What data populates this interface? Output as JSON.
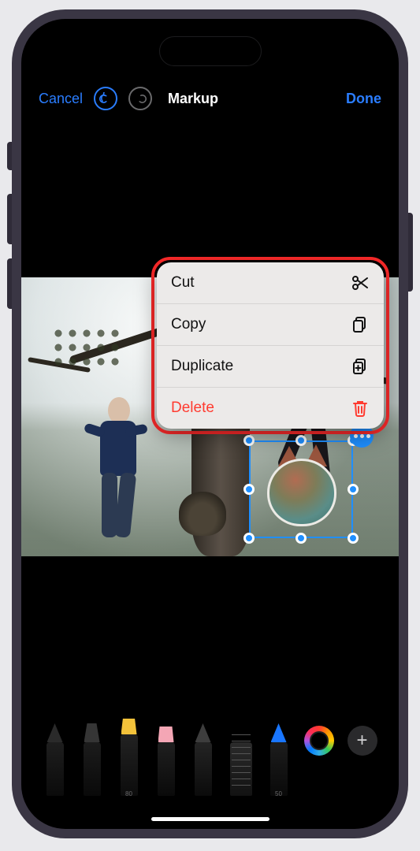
{
  "nav": {
    "cancel": "Cancel",
    "title": "Markup",
    "done": "Done"
  },
  "context_menu": {
    "items": [
      {
        "label": "Cut",
        "icon": "scissors-icon",
        "danger": false
      },
      {
        "label": "Copy",
        "icon": "docs-icon",
        "danger": false
      },
      {
        "label": "Duplicate",
        "icon": "docs-icon",
        "danger": false
      },
      {
        "label": "Delete",
        "icon": "trash-icon",
        "danger": true
      }
    ]
  },
  "tools": {
    "highlighter_value": "80",
    "pencil_value": "50"
  },
  "colors": {
    "accent": "#1f8fff",
    "danger": "#ff3b30",
    "highlight_box": "#ff2a2a"
  }
}
